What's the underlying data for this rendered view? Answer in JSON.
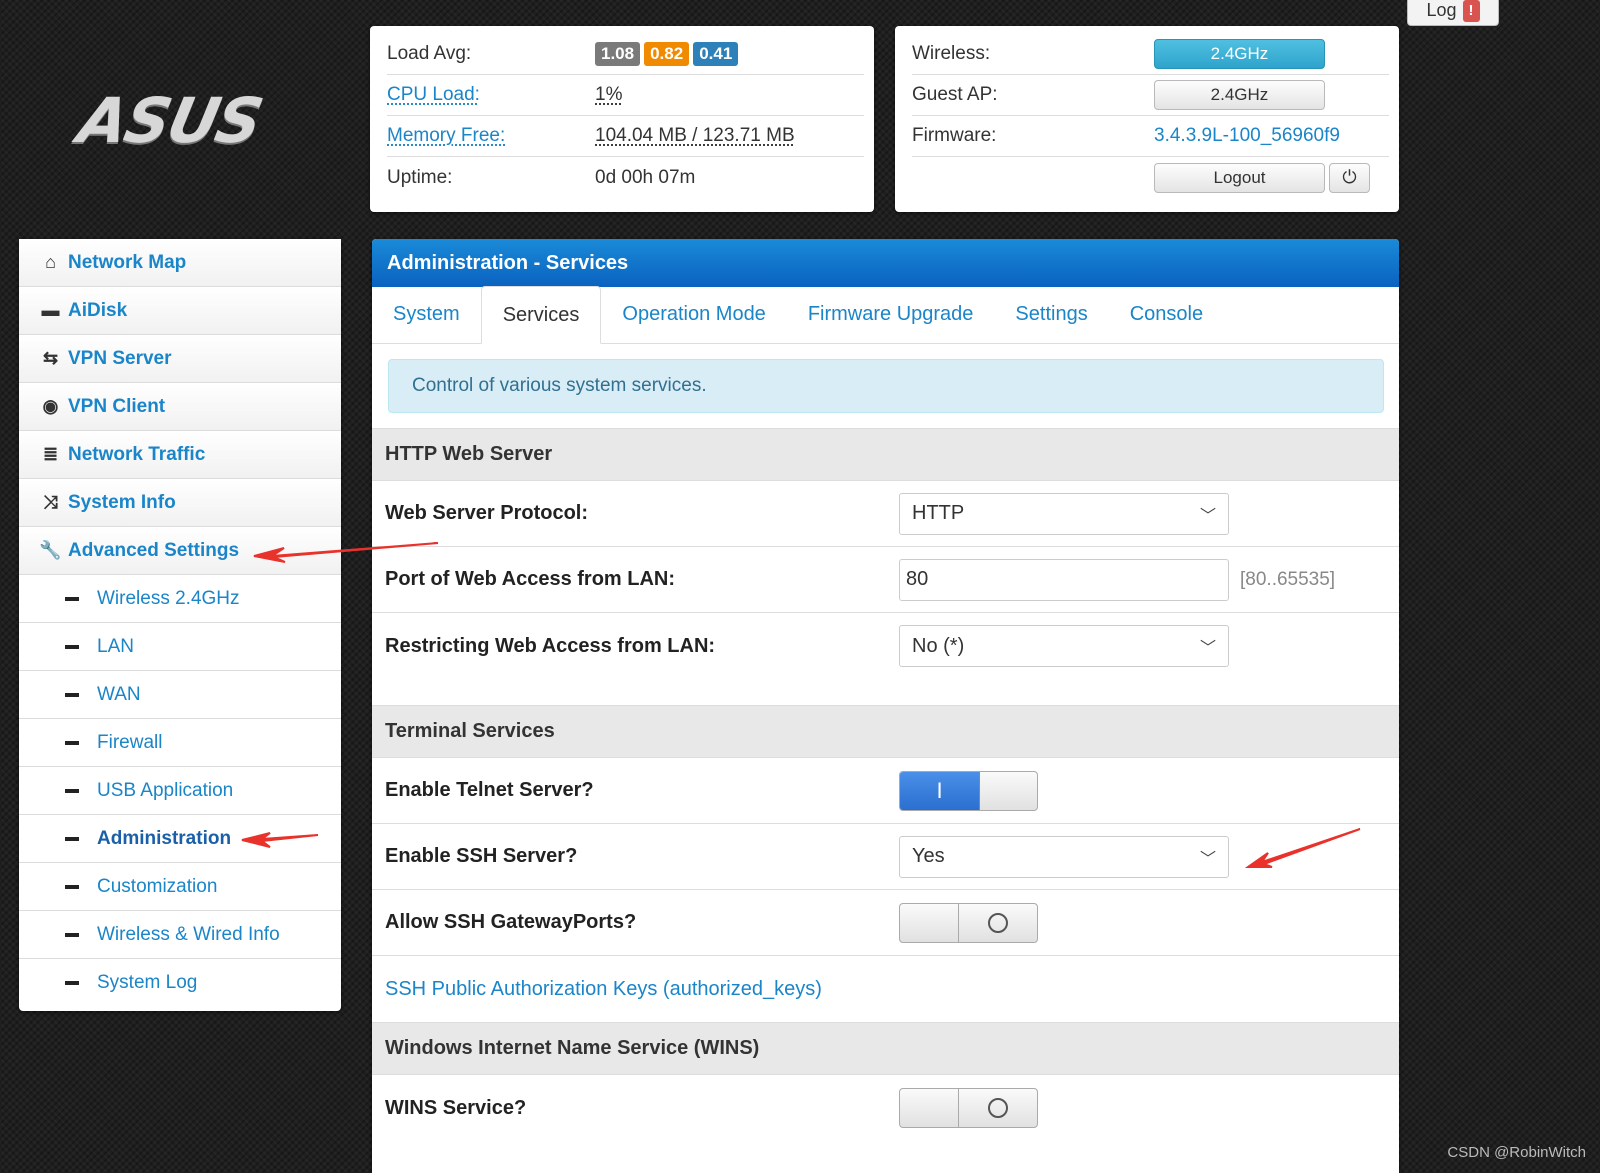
{
  "logo": {
    "text": "ASUS"
  },
  "log_button": {
    "label": "Log",
    "alert": "!"
  },
  "status": {
    "load_avg_label": "Load Avg:",
    "load_avg": [
      "1.08",
      "0.82",
      "0.41"
    ],
    "cpu_label": "CPU Load:",
    "cpu_value": "1%",
    "mem_label": "Memory Free:",
    "mem_value": "104.04 MB / 123.71 MB",
    "uptime_label": "Uptime:",
    "uptime_value": "0d 00h 07m"
  },
  "router": {
    "wireless_label": "Wireless:",
    "wireless_value": "2.4GHz",
    "guest_label": "Guest AP:",
    "guest_value": "2.4GHz",
    "firmware_label": "Firmware:",
    "firmware_value": "3.4.3.9L-100_56960f9",
    "logout_label": "Logout",
    "power_icon": "⏻"
  },
  "sidebar": {
    "items": [
      {
        "label": "Network Map",
        "icon": "home-icon",
        "glyph": "⌂"
      },
      {
        "label": "AiDisk",
        "icon": "disk-icon",
        "glyph": "▬"
      },
      {
        "label": "VPN Server",
        "icon": "retweet-icon",
        "glyph": "⇆"
      },
      {
        "label": "VPN Client",
        "icon": "globe-icon",
        "glyph": "◉"
      },
      {
        "label": "Network Traffic",
        "icon": "tasks-icon",
        "glyph": "≣"
      },
      {
        "label": "System Info",
        "icon": "random-icon",
        "glyph": "⤨"
      },
      {
        "label": "Advanced Settings",
        "icon": "wrench-icon",
        "glyph": "🔧"
      }
    ],
    "subitems": [
      "Wireless 2.4GHz",
      "LAN",
      "WAN",
      "Firewall",
      "USB Application",
      "Administration",
      "Customization",
      "Wireless & Wired Info",
      "System Log"
    ],
    "active_sub": "Administration"
  },
  "main": {
    "title": "Administration - Services",
    "tabs": [
      "System",
      "Services",
      "Operation Mode",
      "Firmware Upgrade",
      "Settings",
      "Console"
    ],
    "active_tab": "Services",
    "info": "Control of various system services.",
    "http": {
      "section": "HTTP Web Server",
      "protocol_label": "Web Server Protocol:",
      "protocol_value": "HTTP",
      "port_label": "Port of Web Access from LAN:",
      "port_value": "80",
      "port_range": "[80..65535]",
      "restrict_label": "Restricting Web Access from LAN:",
      "restrict_value": "No (*)"
    },
    "terminal": {
      "section": "Terminal Services",
      "telnet_label": "Enable Telnet Server?",
      "telnet_on": true,
      "ssh_label": "Enable SSH Server?",
      "ssh_value": "Yes",
      "gateway_label": "Allow SSH GatewayPorts?",
      "gateway_on": false,
      "keys_link": "SSH Public Authorization Keys (authorized_keys)"
    },
    "wins": {
      "section": "Windows Internet Name Service (WINS)",
      "service_label": "WINS Service?",
      "service_on": false
    }
  },
  "watermark": "CSDN @RobinWitch",
  "colors": {
    "accent": "#1a85c8",
    "header": "#0a62c0",
    "annotation": "#e8322b"
  }
}
